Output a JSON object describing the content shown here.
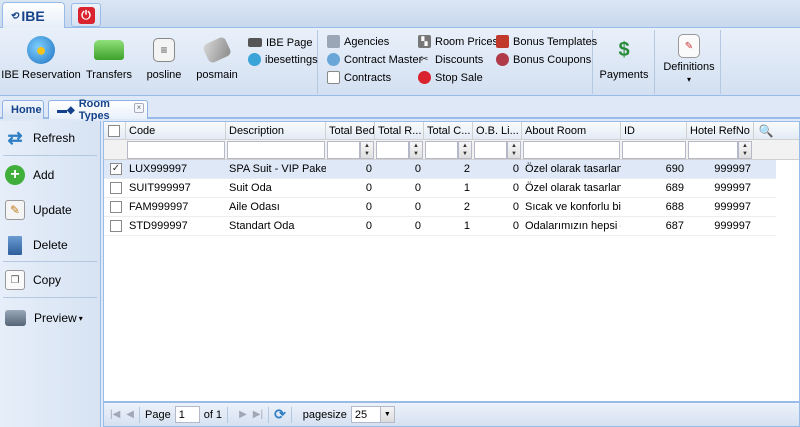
{
  "app": {
    "tab_label": "IBE",
    "logo_text": "⟲"
  },
  "ribbon": {
    "big_buttons": [
      {
        "label": "IBE Reservation",
        "icon": "globe-icon"
      },
      {
        "label": "Transfers",
        "icon": "bus-icon"
      },
      {
        "label": "posline",
        "icon": "list-icon"
      },
      {
        "label": "posmain",
        "icon": "pos-icon"
      }
    ],
    "col1": [
      {
        "label": "IBE Page",
        "icon": "keyboard-icon"
      },
      {
        "label": "ibesettings",
        "icon": "settings-icon"
      }
    ],
    "col2": [
      {
        "label": "Agencies",
        "icon": "agency-icon"
      },
      {
        "label": "Contract Master",
        "icon": "contract-master-icon"
      },
      {
        "label": "Contracts",
        "icon": "document-icon"
      }
    ],
    "col3": [
      {
        "label": "Room Prices",
        "icon": "room-prices-icon"
      },
      {
        "label": "Discounts",
        "icon": "discount-icon"
      },
      {
        "label": "Stop Sale",
        "icon": "stop-icon"
      }
    ],
    "col4": [
      {
        "label": "Bonus Templates",
        "icon": "bonus-templates-icon"
      },
      {
        "label": "Bonus Coupons",
        "icon": "bonus-coupons-icon"
      }
    ],
    "payments": {
      "label": "Payments",
      "icon": "payments-icon"
    },
    "definitions": {
      "label": "Definitions",
      "icon": "definitions-icon",
      "arrow": "▾"
    }
  },
  "doc_tabs": {
    "home": "Home",
    "room_types": "Room Types"
  },
  "side": {
    "refresh": "Refresh",
    "add": "Add",
    "update": "Update",
    "delete": "Delete",
    "copy": "Copy",
    "preview": "Preview"
  },
  "grid": {
    "columns": [
      "Code",
      "Description",
      "Total Bed",
      "Total R...",
      "Total C...",
      "O.B. Li...",
      "About Room",
      "ID",
      "Hotel RefNo"
    ],
    "rows": [
      {
        "checked": true,
        "code": "LUX999997",
        "description": "SPA Suit - VIP Paket",
        "total_bed": "0",
        "total_r": "0",
        "total_c": "2",
        "ob_li": "0",
        "about": "Özel olarak tasarlan...",
        "id": "690",
        "hotel_refno": "999997"
      },
      {
        "checked": false,
        "code": "SUIT999997",
        "description": "Suit Oda",
        "total_bed": "0",
        "total_r": "0",
        "total_c": "1",
        "ob_li": "0",
        "about": "Özel olarak tasarlan...",
        "id": "689",
        "hotel_refno": "999997"
      },
      {
        "checked": false,
        "code": "FAM999997",
        "description": "Aile Odası",
        "total_bed": "0",
        "total_r": "0",
        "total_c": "2",
        "ob_li": "0",
        "about": "Sıcak ve konforlu bir...",
        "id": "688",
        "hotel_refno": "999997"
      },
      {
        "checked": false,
        "code": "STD999997",
        "description": "Standart Oda",
        "total_bed": "0",
        "total_r": "0",
        "total_c": "1",
        "ob_li": "0",
        "about": "Odalarımızın hepsi d...",
        "id": "687",
        "hotel_refno": "999997"
      }
    ]
  },
  "pager": {
    "page_label": "Page",
    "page_value": "1",
    "of_label": "of 1",
    "pagesize_label": "pagesize",
    "pagesize_value": "25"
  },
  "colors": {
    "accent": "#15428b",
    "border": "#99bbe8",
    "selected_row": "#dfe8f6"
  }
}
